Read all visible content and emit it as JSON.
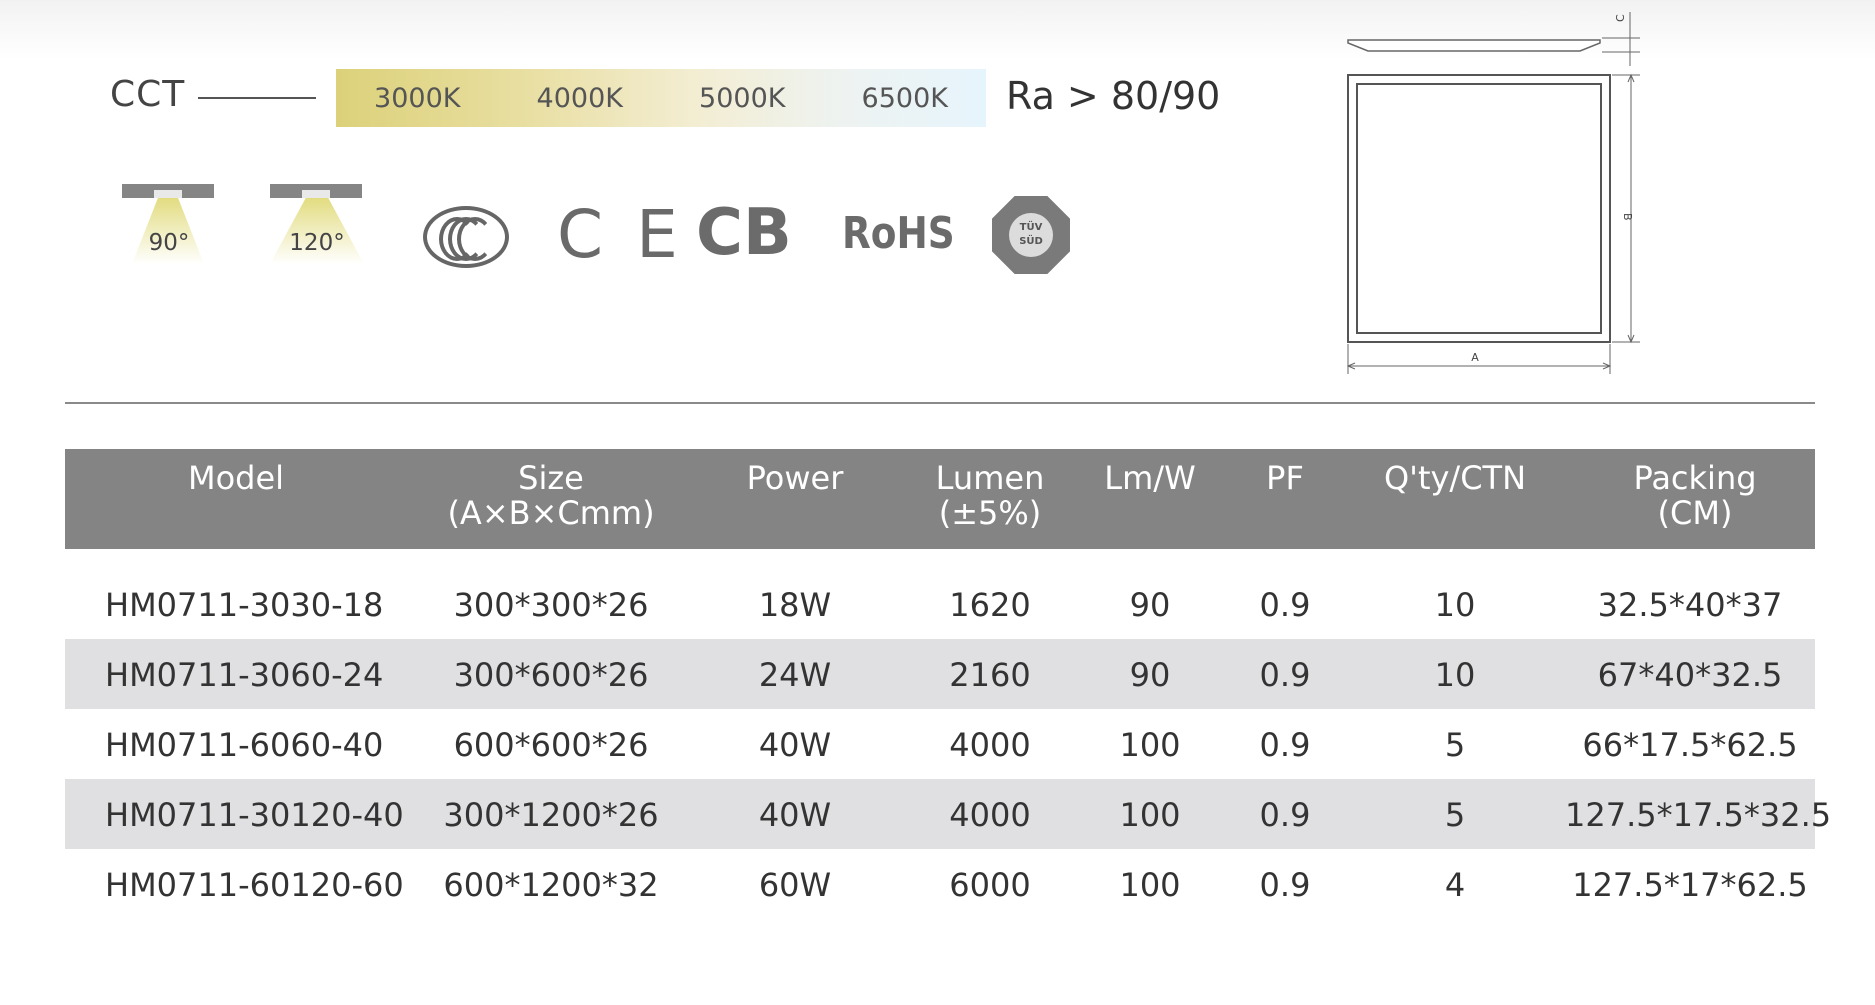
{
  "cct": {
    "label": "CCT",
    "temps": [
      "3000K",
      "4000K",
      "5000K",
      "6500K"
    ],
    "ra": "Ra > 80/90"
  },
  "beams": [
    "90°",
    "120°"
  ],
  "certifications": {
    "ce": "C E",
    "cb": "CB",
    "rohs": "RoHS",
    "tuv": "TÜV",
    "tuv_sub": "SÜD"
  },
  "drawing": {
    "label_a": "A",
    "label_b": "B",
    "label_c": "C"
  },
  "table": {
    "headers": [
      {
        "line1": "Model",
        "line2": ""
      },
      {
        "line1": "Size",
        "line2": "(A×B×Cmm)"
      },
      {
        "line1": "Power",
        "line2": ""
      },
      {
        "line1": "Lumen",
        "line2": "(±5%)"
      },
      {
        "line1": "Lm/W",
        "line2": ""
      },
      {
        "line1": "PF",
        "line2": ""
      },
      {
        "line1": "Q'ty/CTN",
        "line2": ""
      },
      {
        "line1": "Packing",
        "line2": "(CM)"
      }
    ],
    "rows": [
      [
        "HM0711-3030-18",
        "300*300*26",
        "18W",
        "1620",
        "90",
        "0.9",
        "10",
        "32.5*40*37"
      ],
      [
        "HM0711-3060-24",
        "300*600*26",
        "24W",
        "2160",
        "90",
        "0.9",
        "10",
        "67*40*32.5"
      ],
      [
        "HM0711-6060-40",
        "600*600*26",
        "40W",
        "4000",
        "100",
        "0.9",
        "5",
        "66*17.5*62.5"
      ],
      [
        "HM0711-30120-40",
        "300*1200*26",
        "40W",
        "4000",
        "100",
        "0.9",
        "5",
        "127.5*17.5*32.5"
      ],
      [
        "HM0711-60120-60",
        "600*1200*32",
        "60W",
        "6000",
        "100",
        "0.9",
        "4",
        "127.5*17*62.5"
      ]
    ]
  }
}
